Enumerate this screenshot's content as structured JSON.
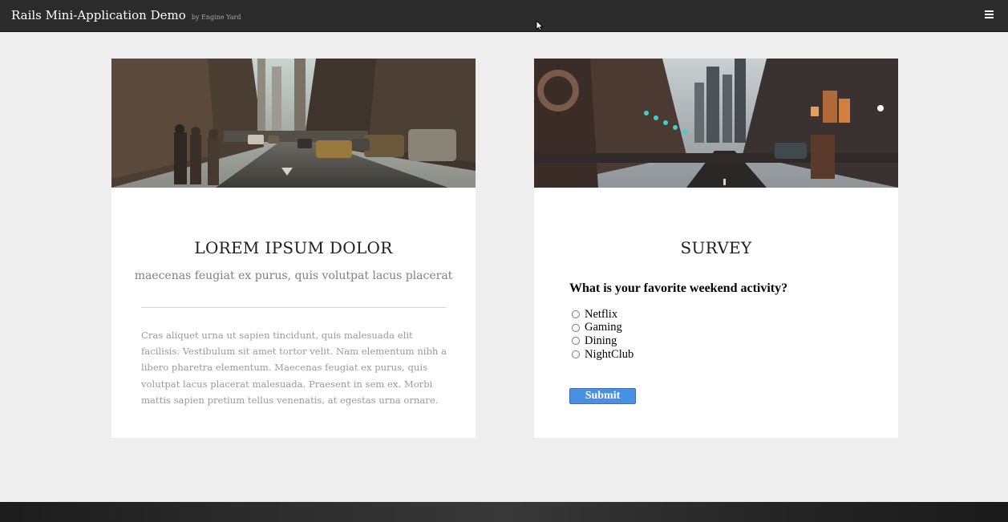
{
  "header": {
    "title": "Rails Mini-Application Demo",
    "subtitle": "by Engine Yard",
    "menu_icon": "hamburger-menu-icon"
  },
  "cards": {
    "left": {
      "image": "city-street-traffic-photo",
      "title": "LOREM IPSUM DOLOR",
      "subtitle": "maecenas feugiat ex purus, quis volutpat lacus placerat",
      "body": "Cras aliquet urna ut sapien tincidunt, quis malesuada elit facilisis. Vestibulum sit amet tortor velit. Nam elementum nibh a libero pharetra elementum. Maecenas feugiat ex purus, quis volutpat lacus placerat malesuada. Praesent in sem ex. Morbi mattis sapien pretium tellus venenatis, at egestas urna ornare."
    },
    "right": {
      "image": "city-street-night-photo",
      "title": "SURVEY",
      "question": "What is your favorite weekend activity?",
      "options": [
        "Netflix",
        "Gaming",
        "Dining",
        "NightClub"
      ],
      "submit_label": "Submit"
    }
  },
  "colors": {
    "topbar": "#2b2b2b",
    "page_background": "#eeeeee",
    "card_background": "#ffffff",
    "submit_button": "#4a90e2"
  }
}
